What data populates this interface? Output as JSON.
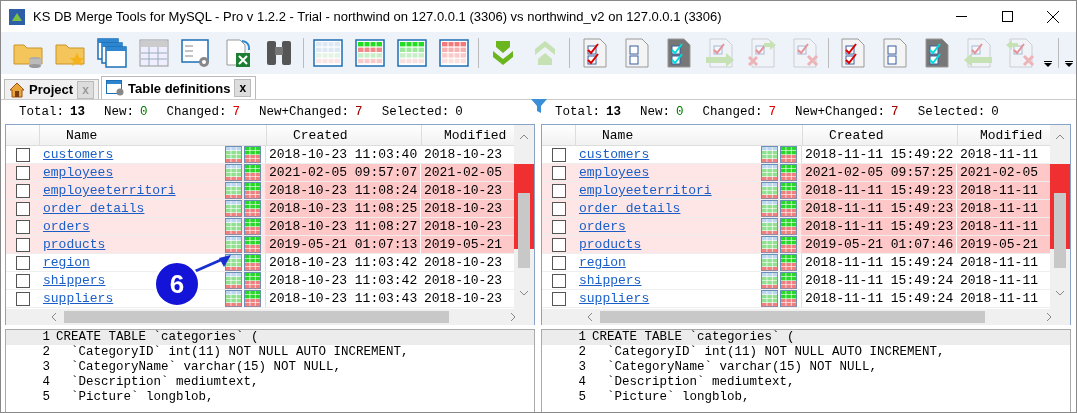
{
  "window": {
    "title": "KS DB Merge Tools for MySQL - Pro v 1.2.2 - Trial - northwind on 127.0.0.1 (3306) vs northwind_v2 on 127.0.0.1 (3306)"
  },
  "toolbar": [
    {
      "kind": "folder-db",
      "disabled": false
    },
    {
      "kind": "folder-star",
      "disabled": false
    },
    {
      "kind": "tables",
      "disabled": false
    },
    {
      "kind": "select-table",
      "disabled": false
    },
    {
      "kind": "table-settings",
      "disabled": false
    },
    {
      "kind": "excel",
      "disabled": false
    },
    {
      "kind": "binoculars",
      "disabled": false
    },
    {
      "kind": "separator"
    },
    {
      "kind": "grid-plain",
      "disabled": false
    },
    {
      "kind": "grid-green-red",
      "disabled": false
    },
    {
      "kind": "grid-green",
      "disabled": false
    },
    {
      "kind": "grid-red",
      "disabled": false
    },
    {
      "kind": "separator"
    },
    {
      "kind": "arrow-down",
      "disabled": false
    },
    {
      "kind": "arrow-up",
      "disabled": true
    },
    {
      "kind": "separator"
    },
    {
      "kind": "doc-checked",
      "disabled": false
    },
    {
      "kind": "doc-unchecked",
      "disabled": false
    },
    {
      "kind": "doc-dark",
      "disabled": false
    },
    {
      "kind": "doc-arrow-right",
      "disabled": true
    },
    {
      "kind": "doc-cross-arrow",
      "disabled": true
    },
    {
      "kind": "doc-cross",
      "disabled": true
    },
    {
      "kind": "separator"
    },
    {
      "kind": "doc-checked",
      "disabled": false
    },
    {
      "kind": "doc-unchecked",
      "disabled": false
    },
    {
      "kind": "doc-dark",
      "disabled": false
    },
    {
      "kind": "doc-arrow-left",
      "disabled": true
    },
    {
      "kind": "doc-cross-left",
      "disabled": true
    },
    {
      "kind": "overflow"
    },
    {
      "kind": "separator"
    },
    {
      "kind": "overflow"
    }
  ],
  "tabs": [
    {
      "label": "Project",
      "selected": false,
      "close": "x"
    },
    {
      "label": "Table definitions",
      "selected": true,
      "close": "x"
    }
  ],
  "panels": [
    {
      "stats": [
        {
          "label": "Total:",
          "value": "13"
        },
        {
          "label": "New:",
          "value": "0",
          "color": "#008000"
        },
        {
          "label": "Changed:",
          "value": "7",
          "color": "#e00000"
        },
        {
          "label": "New+Changed:",
          "value": "7",
          "color": "#a00000"
        },
        {
          "label": "Selected:",
          "value": "0"
        }
      ],
      "columns": [
        "Name",
        "Created",
        "Modified"
      ],
      "rows": [
        {
          "name": "customers",
          "created": "2018-10-23 11:03:40",
          "modified": "2018-10-23",
          "changed": false,
          "checked": false
        },
        {
          "name": "employees",
          "created": "2021-02-05 09:57:07",
          "modified": "2021-02-05",
          "changed": true,
          "checked": false
        },
        {
          "name": "employeeterritori",
          "created": "2018-10-23 11:08:24",
          "modified": "2018-10-23",
          "changed": true,
          "checked": false
        },
        {
          "name": "order details",
          "created": "2018-10-23 11:08:25",
          "modified": "2018-10-23",
          "changed": true,
          "checked": false
        },
        {
          "name": "orders",
          "created": "2018-10-23 11:08:27",
          "modified": "2018-10-23",
          "changed": true,
          "checked": false
        },
        {
          "name": "products",
          "created": "2019-05-21 01:07:13",
          "modified": "2019-05-21",
          "changed": true,
          "checked": false
        },
        {
          "name": "region",
          "created": "2018-10-23 11:03:42",
          "modified": "2018-10-23",
          "changed": false,
          "checked": false
        },
        {
          "name": "shippers",
          "created": "2018-10-23 11:03:42",
          "modified": "2018-10-23",
          "changed": false,
          "checked": false
        },
        {
          "name": "suppliers",
          "created": "2018-10-23 11:03:43",
          "modified": "2018-10-23",
          "changed": false,
          "checked": false
        }
      ],
      "code": [
        {
          "number": "1",
          "text": "CREATE TABLE `categories` ("
        },
        {
          "number": "2",
          "text": "  `CategoryID` int(11) NOT NULL AUTO INCREMENT,"
        },
        {
          "number": "3",
          "text": "  `CategoryName` varchar(15) NOT NULL,"
        },
        {
          "number": "4",
          "text": "  `Description` mediumtext,"
        },
        {
          "number": "5",
          "text": "  `Picture` longblob,"
        }
      ]
    },
    {
      "stats": [
        {
          "label": "Total:",
          "value": "13"
        },
        {
          "label": "New:",
          "value": "0",
          "color": "#008000"
        },
        {
          "label": "Changed:",
          "value": "7",
          "color": "#e00000"
        },
        {
          "label": "New+Changed:",
          "value": "7",
          "color": "#a00000"
        },
        {
          "label": "Selected:",
          "value": "0"
        }
      ],
      "columns": [
        "Name",
        "Created",
        "Modified"
      ],
      "rows": [
        {
          "name": "customers",
          "created": "2018-11-11 15:49:22",
          "modified": "2018-11-11",
          "changed": false,
          "checked": false
        },
        {
          "name": "employees",
          "created": "2021-02-05 09:57:25",
          "modified": "2021-02-05",
          "changed": true,
          "checked": false
        },
        {
          "name": "employeeterritori",
          "created": "2018-11-11 15:49:23",
          "modified": "2018-11-11",
          "changed": true,
          "checked": false
        },
        {
          "name": "order details",
          "created": "2018-11-11 15:49:23",
          "modified": "2018-11-11",
          "changed": true,
          "checked": false
        },
        {
          "name": "orders",
          "created": "2018-11-11 15:49:23",
          "modified": "2018-11-11",
          "changed": true,
          "checked": false
        },
        {
          "name": "products",
          "created": "2019-05-21 01:07:46",
          "modified": "2019-05-21",
          "changed": true,
          "checked": false
        },
        {
          "name": "region",
          "created": "2018-11-11 15:49:24",
          "modified": "2018-11-11",
          "changed": false,
          "checked": false
        },
        {
          "name": "shippers",
          "created": "2018-11-11 15:49:24",
          "modified": "2018-11-11",
          "changed": false,
          "checked": false
        },
        {
          "name": "suppliers",
          "created": "2018-11-11 15:49:24",
          "modified": "2018-11-11",
          "changed": false,
          "checked": false
        }
      ],
      "code": [
        {
          "number": "1",
          "text": "CREATE TABLE `categories` ("
        },
        {
          "number": "2",
          "text": "  `CategoryID` int(11) NOT NULL AUTO INCREMENT,"
        },
        {
          "number": "3",
          "text": "  `CategoryName` varchar(15) NOT NULL,"
        },
        {
          "number": "4",
          "text": "  `Description` mediumtext,"
        },
        {
          "number": "5",
          "text": "  `Picture` longblob,"
        }
      ]
    }
  ],
  "callout": {
    "label": "6"
  }
}
